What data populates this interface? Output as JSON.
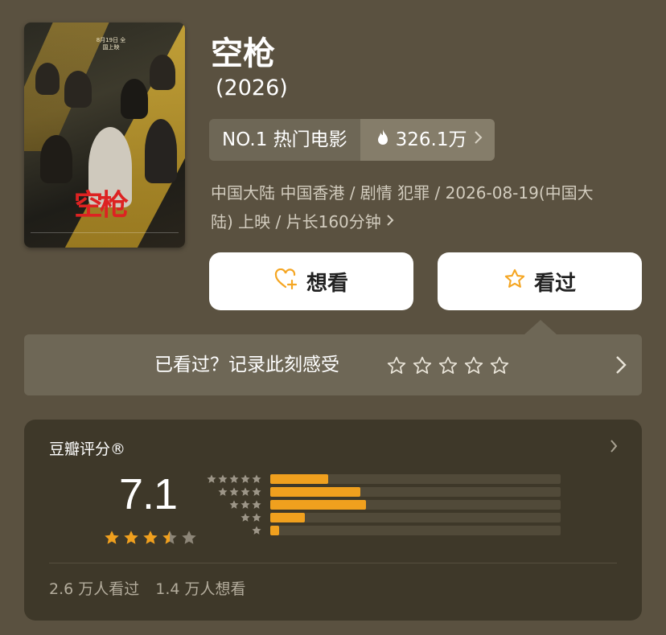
{
  "movie": {
    "title": "空枪",
    "year": "(2026)",
    "rank_label": "NO.1 热门电影",
    "heat": "326.1万",
    "meta_line1": "中国大陆 中国香港 / 剧情 犯罪 / 2026-08-19(中国大",
    "meta_line2": "陆) 上映 / 片长160分钟",
    "poster_title": "空枪",
    "poster_date": "8月19日 全国上映"
  },
  "actions": {
    "want_label": "想看",
    "seen_label": "看过"
  },
  "record": {
    "prompt": "已看过？记录此刻感受",
    "stars": 5
  },
  "rating": {
    "label": "豆瓣评分®",
    "score": "7.1",
    "avg_stars": 3.5,
    "distribution": [
      {
        "stars": 5,
        "fraction": 0.2
      },
      {
        "stars": 4,
        "fraction": 0.31
      },
      {
        "stars": 3,
        "fraction": 0.33
      },
      {
        "stars": 2,
        "fraction": 0.12
      },
      {
        "stars": 1,
        "fraction": 0.03
      }
    ],
    "seen_count": "2.6 万人看过",
    "want_count": "1.4 万人想看"
  },
  "colors": {
    "background": "#5a5140",
    "accent_star": "#f0a01e",
    "card": "#3e3829",
    "icon_orange": "#f5a623"
  },
  "icons": [
    "flame-icon",
    "chevron-right-icon",
    "heart-plus-icon",
    "star-outline-icon"
  ]
}
